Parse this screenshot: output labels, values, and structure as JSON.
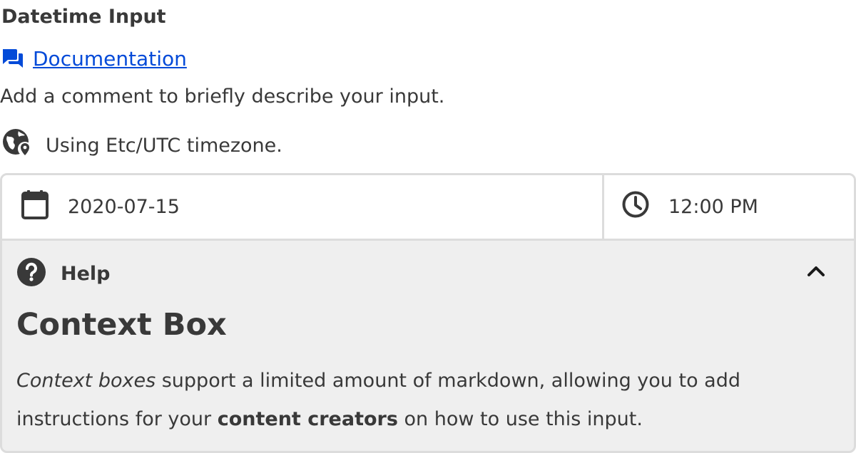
{
  "field": {
    "label": "Datetime Input",
    "documentation_link": "Documentation",
    "comment": "Add a comment to briefly describe your input.",
    "timezone_note": "Using Etc/UTC timezone."
  },
  "inputs": {
    "date_value": "2020-07-15",
    "time_value": "12:00 PM"
  },
  "help": {
    "header": "Help",
    "context_title": "Context Box",
    "body": {
      "italic_part": "Context boxes",
      "part1": " support a limited amount of markdown, allowing you to add instructions for your ",
      "bold_part": "content creators",
      "part2": " on how to use this input."
    }
  },
  "colors": {
    "link": "#034ad8",
    "text": "#393939",
    "border": "#dcdcdc",
    "help_bg": "#efefef"
  },
  "icons": {
    "documentation": "chat-bubbles-icon",
    "timezone": "globe-pin-icon",
    "date": "calendar-icon",
    "time": "clock-icon",
    "help": "question-circle-icon",
    "collapse": "chevron-up-icon"
  }
}
